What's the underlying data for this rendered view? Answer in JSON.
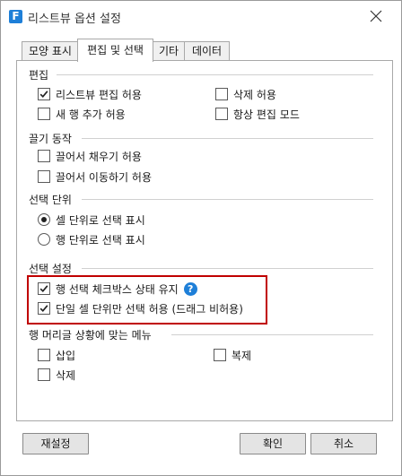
{
  "window": {
    "title": "리스트뷰 옵션 설정",
    "app_icon": "F"
  },
  "tabs": [
    {
      "label": "모양 표시",
      "active": false
    },
    {
      "label": "편집 및 선택",
      "active": true
    },
    {
      "label": "기타",
      "active": false
    },
    {
      "label": "데이터",
      "active": false
    }
  ],
  "groups": {
    "edit": {
      "title": "편집",
      "options": [
        {
          "label": "리스트뷰 편집 허용",
          "checked": true
        },
        {
          "label": "삭제 허용",
          "checked": false
        },
        {
          "label": "새 행 추가 허용",
          "checked": false
        },
        {
          "label": "항상 편집 모드",
          "checked": false
        }
      ]
    },
    "drag": {
      "title": "끌기 동작",
      "options": [
        {
          "label": "끌어서 채우기 허용",
          "checked": false
        },
        {
          "label": "끌어서 이동하기 허용",
          "checked": false
        }
      ]
    },
    "select_unit": {
      "title": "선택 단위",
      "options": [
        {
          "label": "셀 단위로 선택 표시",
          "selected": true
        },
        {
          "label": "행 단위로 선택 표시",
          "selected": false
        }
      ]
    },
    "select_setting": {
      "title": "선택 설정",
      "options": [
        {
          "label": "행 선택 체크박스 상태 유지",
          "checked": true
        },
        {
          "label": "단일 셀 단위만 선택 허용 (드래그 비허용)",
          "checked": true
        }
      ],
      "help": "?"
    },
    "row_header_menu": {
      "title": "행 머리글 상황에 맞는 메뉴",
      "options": [
        {
          "label": "삽입",
          "checked": false
        },
        {
          "label": "복제",
          "checked": false
        },
        {
          "label": "삭제",
          "checked": false
        }
      ]
    }
  },
  "buttons": {
    "reset": "재설정",
    "ok": "확인",
    "cancel": "취소"
  },
  "colors": {
    "highlight": "#c00000",
    "accent": "#1e7fd8"
  }
}
